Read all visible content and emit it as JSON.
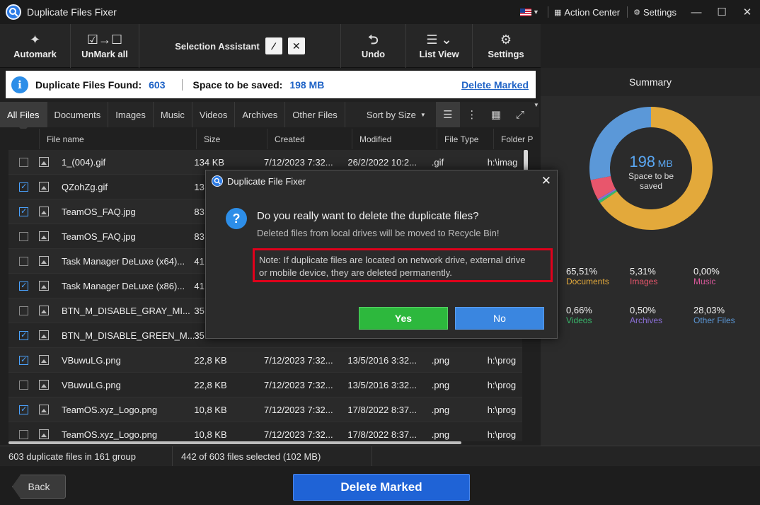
{
  "window": {
    "title": "Duplicate Files Fixer",
    "action_center": "Action Center",
    "settings": "Settings"
  },
  "toolbar": {
    "automark": "Automark",
    "unmark_all": "UnMark all",
    "selection_assistant": "Selection Assistant",
    "undo": "Undo",
    "list_view": "List View",
    "settings": "Settings"
  },
  "info": {
    "found_label": "Duplicate Files Found:",
    "found_value": "603",
    "space_label": "Space to be saved:",
    "space_value": "198 MB",
    "delete_marked_link": "Delete Marked"
  },
  "tabs": [
    "All Files",
    "Documents",
    "Images",
    "Music",
    "Videos",
    "Archives",
    "Other Files"
  ],
  "sort_label": "Sort by Size",
  "columns": [
    "File name",
    "Size",
    "Created",
    "Modified",
    "File Type",
    "Folder P"
  ],
  "rows": [
    {
      "checked": false,
      "name": "1_(004).gif",
      "size": "134 KB",
      "created": "7/12/2023 7:32...",
      "modified": "26/2/2022 10:2...",
      "type": ".gif",
      "folder": "h:\\imag"
    },
    {
      "checked": true,
      "name": "QZohZg.gif",
      "size": "13",
      "created": "",
      "modified": "",
      "type": "",
      "folder": ""
    },
    {
      "checked": true,
      "name": "TeamOS_FAQ.jpg",
      "size": "83",
      "created": "",
      "modified": "",
      "type": "",
      "folder": ""
    },
    {
      "checked": false,
      "name": "TeamOS_FAQ.jpg",
      "size": "83",
      "created": "",
      "modified": "",
      "type": "",
      "folder": ""
    },
    {
      "checked": false,
      "name": "Task Manager DeLuxe (x64)...",
      "size": "41",
      "created": "",
      "modified": "",
      "type": "",
      "folder": ""
    },
    {
      "checked": true,
      "name": "Task Manager DeLuxe (x86)...",
      "size": "41",
      "created": "",
      "modified": "",
      "type": "",
      "folder": ""
    },
    {
      "checked": false,
      "name": "BTN_M_DISABLE_GRAY_MI...",
      "size": "35",
      "created": "",
      "modified": "",
      "type": "",
      "folder": ""
    },
    {
      "checked": true,
      "name": "BTN_M_DISABLE_GREEN_M...",
      "size": "35",
      "created": "",
      "modified": "",
      "type": "",
      "folder": ""
    },
    {
      "checked": true,
      "name": "VBuwuLG.png",
      "size": "22,8 KB",
      "created": "7/12/2023 7:32...",
      "modified": "13/5/2016 3:32...",
      "type": ".png",
      "folder": "h:\\prog"
    },
    {
      "checked": false,
      "name": "VBuwuLG.png",
      "size": "22,8 KB",
      "created": "7/12/2023 7:32...",
      "modified": "13/5/2016 3:32...",
      "type": ".png",
      "folder": "h:\\prog"
    },
    {
      "checked": true,
      "name": "TeamOS.xyz_Logo.png",
      "size": "10,8 KB",
      "created": "7/12/2023 7:32...",
      "modified": "17/8/2022 8:37...",
      "type": ".png",
      "folder": "h:\\prog"
    },
    {
      "checked": false,
      "name": "TeamOS.xyz_Logo.png",
      "size": "10,8 KB",
      "created": "7/12/2023 7:32...",
      "modified": "17/8/2022 8:37...",
      "type": ".png",
      "folder": "h:\\prog"
    }
  ],
  "summary": {
    "title": "Summary",
    "center_value": "198",
    "center_unit": "MB",
    "center_label": "Space to be saved",
    "segments": [
      {
        "name": "Documents",
        "pct": "65,51%",
        "value": 65.51,
        "color": "#e3a93b"
      },
      {
        "name": "Images",
        "pct": "5,31%",
        "value": 5.31,
        "color": "#e8566c"
      },
      {
        "name": "Music",
        "pct": "0,00%",
        "value": 0.0,
        "color": "#d8589a"
      },
      {
        "name": "Videos",
        "pct": "0,66%",
        "value": 0.66,
        "color": "#39b86b"
      },
      {
        "name": "Archives",
        "pct": "0,50%",
        "value": 0.5,
        "color": "#8a6fd6"
      },
      {
        "name": "Other Files",
        "pct": "28,03%",
        "value": 28.03,
        "color": "#5b98d8"
      }
    ]
  },
  "status": {
    "groups": "603 duplicate files in 161 group",
    "selected": "442 of 603 files selected  (102 MB)"
  },
  "bottom": {
    "back": "Back",
    "delete_marked": "Delete Marked"
  },
  "dialog": {
    "title": "Duplicate File Fixer",
    "question": "Do you really want to delete the duplicate files?",
    "sub": "Deleted files from local drives will be moved to Recycle Bin!",
    "note_line1": "Note: If duplicate files are located on network drive, external drive",
    "note_line2": "or mobile device, they are deleted permanently.",
    "yes": "Yes",
    "no": "No"
  }
}
